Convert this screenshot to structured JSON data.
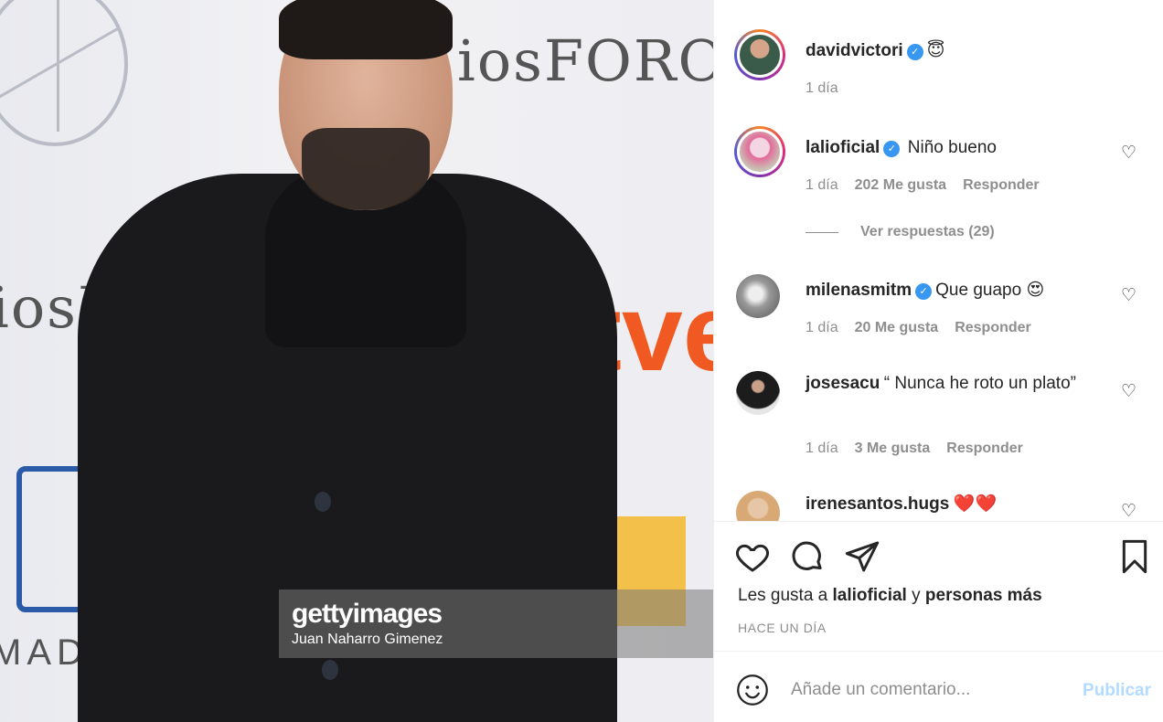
{
  "photo": {
    "watermark_brand": "gettyimages",
    "watermark_credit": "Juan Naharro Gimenez",
    "bg_text_1": "iosFORO",
    "bg_text_2": "iosF",
    "bg_text_3": "MADRI",
    "bg_text_4": "tve"
  },
  "post": {
    "author": "davidvictori",
    "author_emoji": "😇",
    "time": "1 día"
  },
  "comments": [
    {
      "user": "lalioficial",
      "verified": true,
      "text": "Niño bueno",
      "time": "1 día",
      "likes": "202 Me gusta",
      "reply": "Responder"
    },
    {
      "user": "milenasmitm",
      "verified": true,
      "text": "Que guapo 😍",
      "time": "1 día",
      "likes": "20 Me gusta",
      "reply": "Responder"
    },
    {
      "user": "josesacu",
      "verified": false,
      "text": "“ Nunca he roto un plato”",
      "time": "1 día",
      "likes": "3 Me gusta",
      "reply": "Responder"
    },
    {
      "user": "irenesantos.hugs",
      "verified": false,
      "text": "❤️❤️"
    }
  ],
  "view_replies": "Ver respuestas (29)",
  "likes_line": {
    "prefix": "Les gusta a ",
    "user": "lalioficial",
    "mid": " y ",
    "rest": "personas más"
  },
  "posted_when": "HACE UN DÍA",
  "add_comment": {
    "placeholder": "Añade un comentario...",
    "publish": "Publicar"
  },
  "colors": {
    "accent": "#3897f0",
    "publish_disabled": "#b3dbff",
    "tve_orange": "#f05a22"
  },
  "icons": [
    "heart-icon",
    "comment-icon",
    "share-icon",
    "bookmark-icon",
    "emoji-icon",
    "verified-icon"
  ]
}
